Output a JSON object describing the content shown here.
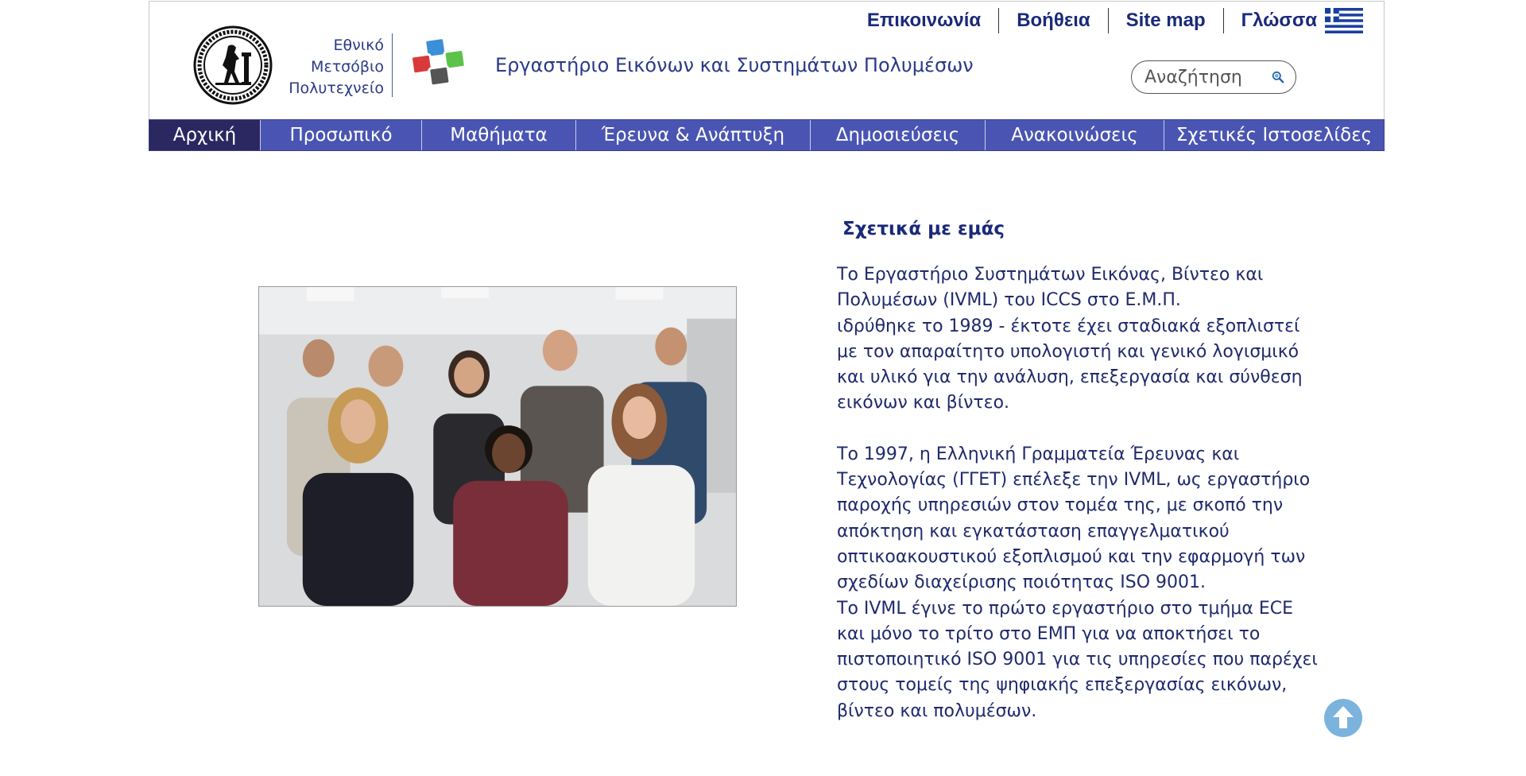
{
  "header": {
    "university_name": [
      "Εθνικό",
      "Μετσόβιο",
      "Πολυτεχνείο"
    ],
    "lab_name": "Εργαστήριο Εικόνων και Συστημάτων Πολυμέσων",
    "top_links": [
      "Επικοινωνία",
      "Βοήθεια",
      "Site map",
      "Γλώσσα"
    ],
    "search_placeholder": "Αναζήτηση",
    "icons": {
      "seal": "university-seal-icon",
      "logo": "lab-logo-icon",
      "flag": "greek-flag-icon",
      "search": "magnifier-icon"
    }
  },
  "nav": {
    "items": [
      {
        "label": "Αρχική",
        "active": true
      },
      {
        "label": "Προσωπικό"
      },
      {
        "label": "Μαθήματα"
      },
      {
        "label": "Έρευνα & Ανάπτυξη"
      },
      {
        "label": "Δημοσιεύσεις"
      },
      {
        "label": "Ανακοινώσεις"
      },
      {
        "label": "Σχετικές Ιστοσελίδες"
      }
    ]
  },
  "about": {
    "title": "Σχετικά με εμάς",
    "lines_block1": [
      "Το Εργαστήριο Συστημάτων Εικόνας, Βίντεο και",
      "Πολυμέσων (IVML) του ICCS στο Ε.Μ.Π.",
      "ιδρύθηκε το 1989 - έκτοτε έχει σταδιακά εξοπλιστεί",
      "με τον απαραίτητο υπολογιστή και γενικό λογισμικό",
      "και υλικό για την ανάλυση, επεξεργασία και σύνθεση",
      "εικόνων και βίντεο."
    ],
    "lines_block2": [
      "Το 1997, η Ελληνική Γραμματεία Έρευνας και",
      "Τεχνολογίας (ΓΓΕΤ) επέλεξε την IVML, ως εργαστήριο",
      "παροχής υπηρεσιών στον τομέα της, με σκοπό την",
      "απόκτηση και εγκατάσταση επαγγελματικού",
      "οπτικοακουστικού εξοπλισμού και την εφαρμογή των",
      "σχεδίων διαχείρισης ποιότητας ISO 9001.",
      "Το IVML έγινε το πρώτο εργαστήριο στο τμήμα ECE",
      "και μόνο το τρίτο στο ΕΜΠ για να αποκτήσει το",
      "πιστοποιητικό ISO 9001 για τις υπηρεσίες που παρέχει",
      "στους τομείς της ψηφιακής επεξεργασίας εικόνων,",
      "βίντεο και πολυμέσων."
    ]
  },
  "colors": {
    "nav_bg": "#4a55b3",
    "nav_active": "#2b2760",
    "text": "#1f2a6b",
    "back_to_top": "#7bb3dd"
  }
}
